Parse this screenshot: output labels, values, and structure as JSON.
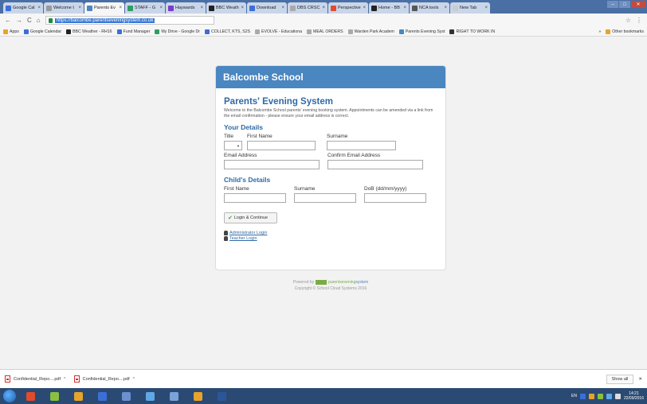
{
  "browser": {
    "tabs": [
      {
        "label": "Google Cal",
        "color": "#3b6fd8",
        "active": false
      },
      {
        "label": "Welcome t",
        "color": "#9a9a9a",
        "active": false
      },
      {
        "label": "Parents Ev",
        "color": "#4a86c0",
        "active": true
      },
      {
        "label": "STAFF - G",
        "color": "#2f9e62",
        "active": false
      },
      {
        "label": "Haywards",
        "color": "#7a3cc9",
        "active": false
      },
      {
        "label": "BBC Weath",
        "color": "#222222",
        "active": false
      },
      {
        "label": "Download",
        "color": "#3b6fd8",
        "active": false
      },
      {
        "label": "DBS CRSC",
        "color": "#aaaaaa",
        "active": false
      },
      {
        "label": "Perspective",
        "color": "#e14b2b",
        "active": false
      },
      {
        "label": "Home - BB",
        "color": "#222222",
        "active": false
      },
      {
        "label": "NCA tools",
        "color": "#555555",
        "active": false
      },
      {
        "label": "New Tab",
        "color": "#cccccc",
        "active": false
      }
    ],
    "url": "https://balcombe.parentseveningsystem.co.uk",
    "bookmarks": [
      {
        "label": "Apps",
        "color": "#e7a32a"
      },
      {
        "label": "Google Calendar",
        "color": "#3b6fd8"
      },
      {
        "label": "BBC Weather - RH16",
        "color": "#222222"
      },
      {
        "label": "Fund Manager",
        "color": "#3b6fd8"
      },
      {
        "label": "My Drive - Google Dr",
        "color": "#2f9e62"
      },
      {
        "label": "COLLECT, KTS, S2S",
        "color": "#3b6fd8"
      },
      {
        "label": "EVOLVE - Educationa",
        "color": "#aaaaaa"
      },
      {
        "label": "MEAL ORDERS",
        "color": "#aaaaaa"
      },
      {
        "label": "Warden Park Academ",
        "color": "#aaaaaa"
      },
      {
        "label": "Parents Evening Syst",
        "color": "#4a86c0"
      },
      {
        "label": "RIGHT TO WORK IN",
        "color": "#333333"
      }
    ],
    "other_bookmarks": "Other bookmarks"
  },
  "card": {
    "school": "Balcombe School",
    "title": "Parents' Evening System",
    "intro": "Welcome to the Balcombe School parents' evening booking system. Appointments can be amended via a link from the email confirmation - please ensure your email address is correct.",
    "your_details": "Your Details",
    "title_label": "Title",
    "first_name_label": "First Name",
    "surname_label": "Surname",
    "email_label": "Email Address",
    "confirm_email_label": "Confirm Email Address",
    "childs_details": "Child's Details",
    "child_first_name_label": "First Name",
    "child_surname_label": "Surname",
    "dob_label": "DoB (dd/mm/yyyy)",
    "login_button": "Login & Continue",
    "admin_login": "Administrator Login",
    "teacher_login": "Teacher Login"
  },
  "footer": {
    "powered_by": "Powered by",
    "brand_a": "parentsevening",
    "brand_b": "system",
    "copyright": "Copyright © School Cloud Systems 2016"
  },
  "downloads": [
    {
      "name": "Confidential_Repo....pdf"
    },
    {
      "name": "Confidential_Repo....pdf"
    }
  ],
  "show_all": "Show all",
  "taskbar": {
    "apps": [
      "#e14b2b",
      "#8bbf3f",
      "#e7a32a",
      "#3b6fd8",
      "#6b8fd0",
      "#5fa8e8",
      "#7aa3d8",
      "#e7a32a",
      "#2b579a"
    ],
    "lang": "EN",
    "time": "14:21",
    "date": "22/09/2016"
  }
}
